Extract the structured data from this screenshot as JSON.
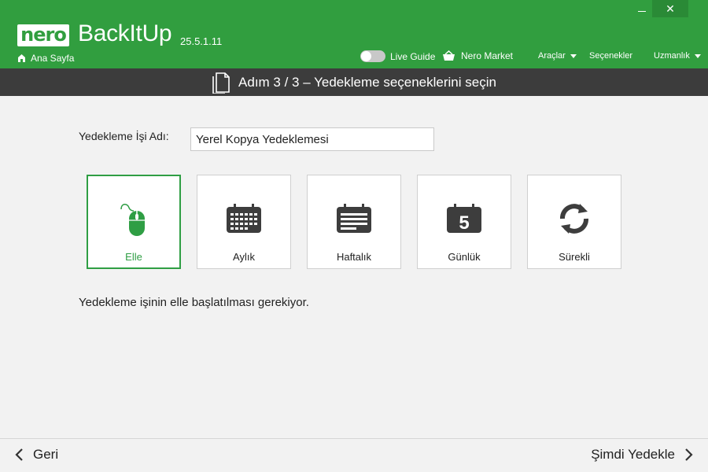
{
  "header": {
    "logo": "nero",
    "app_name": "BackItUp",
    "version": "25.5.1.11",
    "home_label": "Ana Sayfa",
    "close_glyph": "✕",
    "live_guide": "Live Guide",
    "nero_market": "Nero Market",
    "menu": [
      {
        "label": "Araçlar",
        "has_caret": true
      },
      {
        "label": "Seçenekler",
        "has_caret": false
      },
      {
        "label": "Uzmanlık",
        "has_caret": true
      }
    ],
    "accent_color": "#319e3f"
  },
  "step": {
    "title": "Adım 3 / 3 – Yedekleme seçeneklerini seçin"
  },
  "form": {
    "job_name_label": "Yedekleme İşi Adı:",
    "job_name_value": "Yerel Kopya Yedeklemesi"
  },
  "schedule_options": [
    {
      "label": "Elle",
      "icon": "mouse-icon",
      "selected": true
    },
    {
      "label": "Aylık",
      "icon": "calendar-month-icon",
      "selected": false
    },
    {
      "label": "Haftalık",
      "icon": "calendar-week-icon",
      "selected": false
    },
    {
      "label": "Günlük",
      "icon": "calendar-day-icon",
      "day_number": "5",
      "selected": false
    },
    {
      "label": "Sürekli",
      "icon": "refresh-icon",
      "selected": false
    }
  ],
  "description": "Yedekleme işinin elle başlatılması gerekiyor.",
  "footer": {
    "back_label": "Geri",
    "next_label": "Şimdi Yedekle"
  }
}
